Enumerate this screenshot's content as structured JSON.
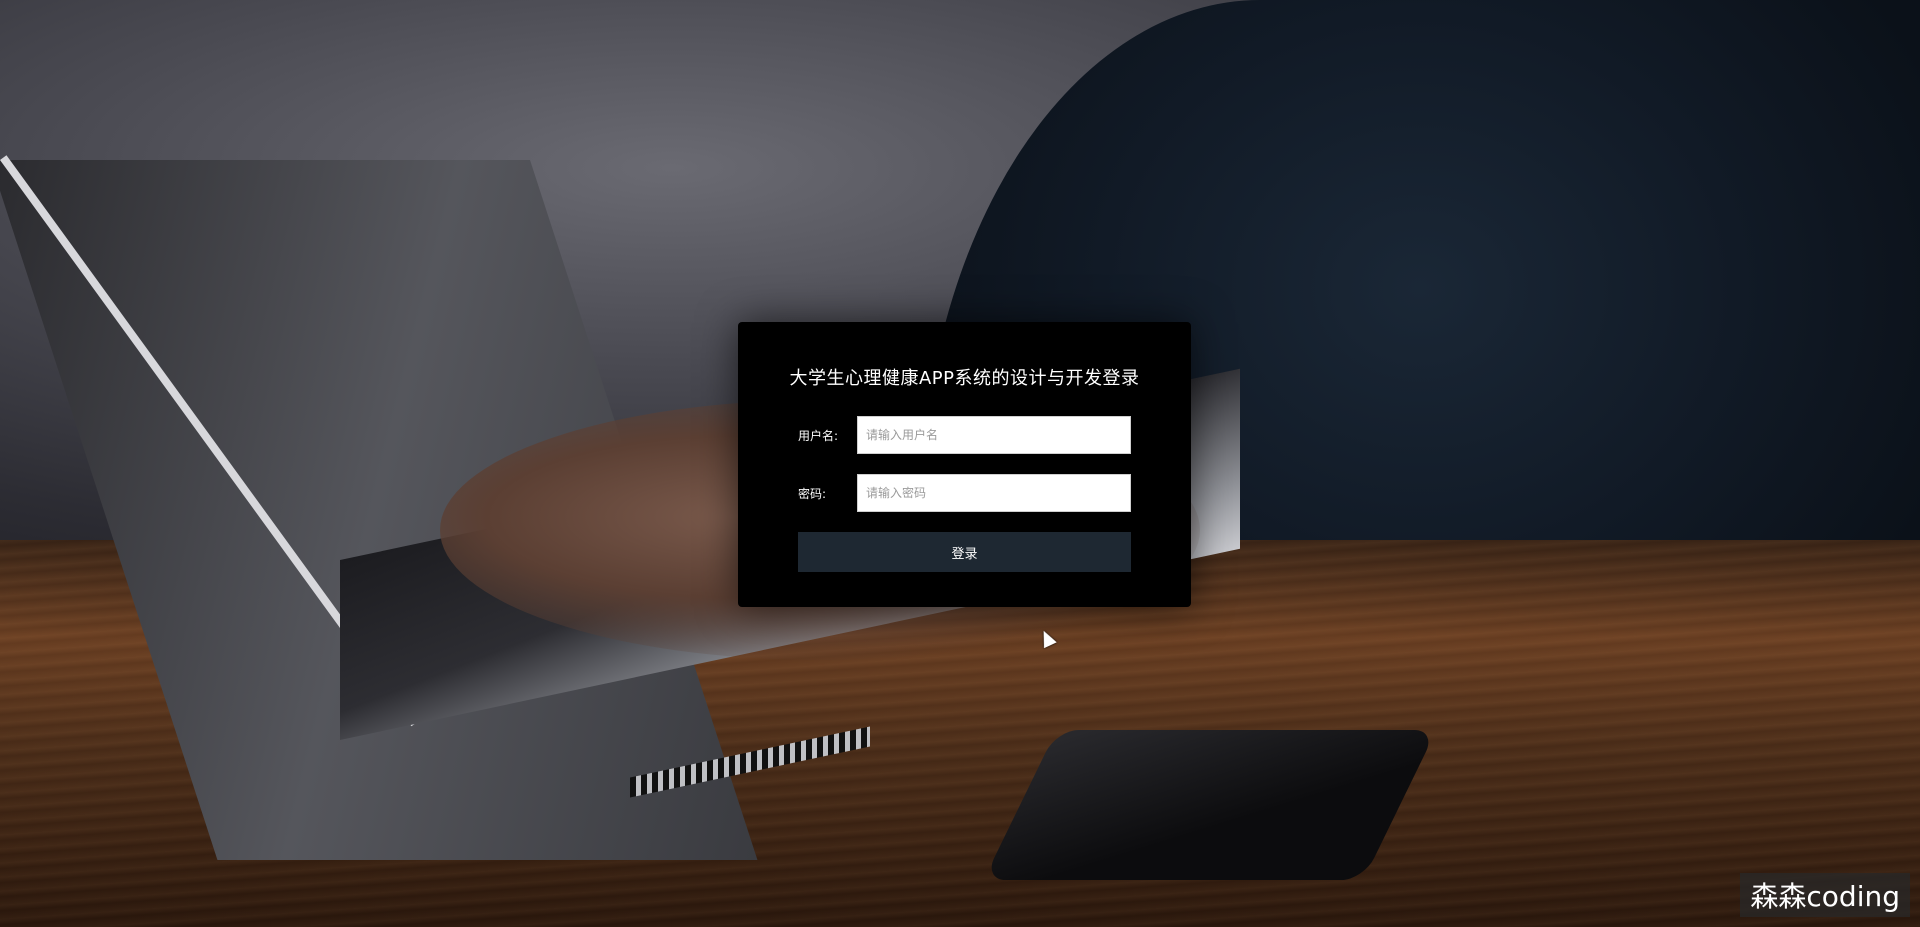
{
  "login": {
    "title": "大学生心理健康APP系统的设计与开发登录",
    "username_label": "用户名:",
    "username_placeholder": "请输入用户名",
    "username_value": "",
    "password_label": "密码:",
    "password_placeholder": "请输入密码",
    "password_value": "",
    "submit_label": "登录"
  },
  "watermark": {
    "text": "森森coding"
  },
  "colors": {
    "card_background": "#000000",
    "button_background": "#1e2832",
    "text_primary": "#ffffff"
  },
  "icons": {
    "cursor": "mouse-pointer-icon"
  }
}
